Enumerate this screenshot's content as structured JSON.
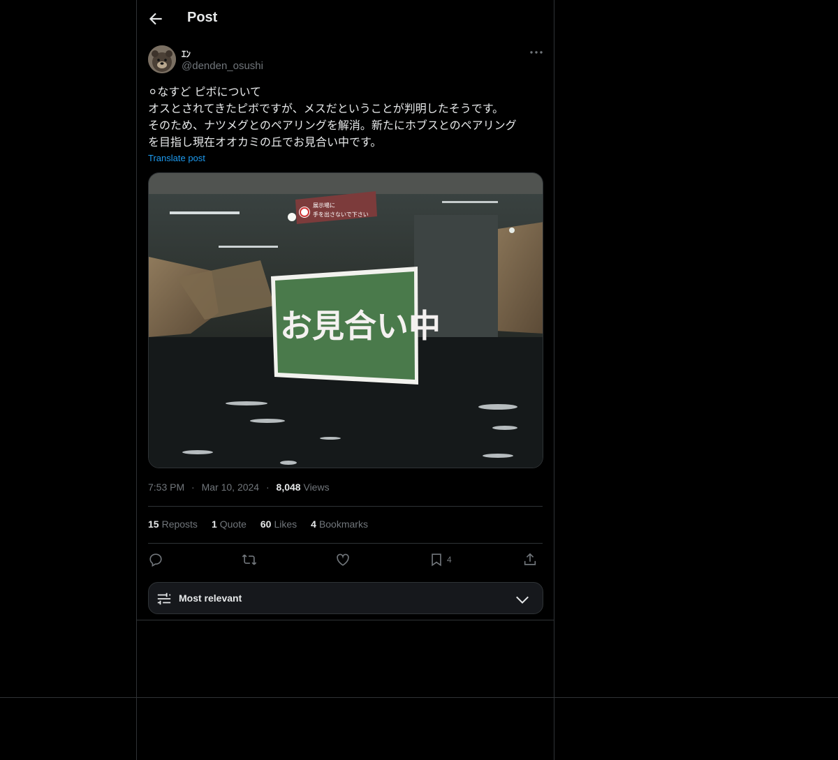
{
  "header": {
    "title": "Post",
    "back_icon": "arrow-left-icon"
  },
  "author": {
    "display_name": "ｴﾝ",
    "handle": "@denden_osushi",
    "avatar_icon": "bear-avatar"
  },
  "post": {
    "text": "⚪︎なすど ピボについて\nオスとされてきたピボですが、メスだということが判明したそうです。\nそのため、ナツメグとのペアリングを解消。新たにホブスとのペアリング\nを目指し現在オオカミの丘でお見合い中です。",
    "translate_label": "Translate post",
    "image": {
      "sign_text": "お見合い中",
      "warning_sign_line1": "展示場に",
      "warning_sign_line2": "手を出さないで下さい"
    },
    "time": "7:53 PM",
    "date": "Mar 10, 2024",
    "views_count": "8,048",
    "views_label": "Views",
    "separator": "·"
  },
  "stats": [
    {
      "count": "15",
      "label": "Reposts"
    },
    {
      "count": "1",
      "label": "Quote"
    },
    {
      "count": "60",
      "label": "Likes"
    },
    {
      "count": "4",
      "label": "Bookmarks"
    }
  ],
  "actions": {
    "bookmark_count": "4",
    "icons": [
      "reply-icon",
      "repost-icon",
      "like-icon",
      "bookmark-icon",
      "share-icon"
    ]
  },
  "sort": {
    "label": "Most relevant"
  },
  "colors": {
    "background": "#000000",
    "text": "#e7e9ea",
    "muted": "#71767b",
    "link": "#1d9bf0",
    "border": "#2f3336"
  }
}
